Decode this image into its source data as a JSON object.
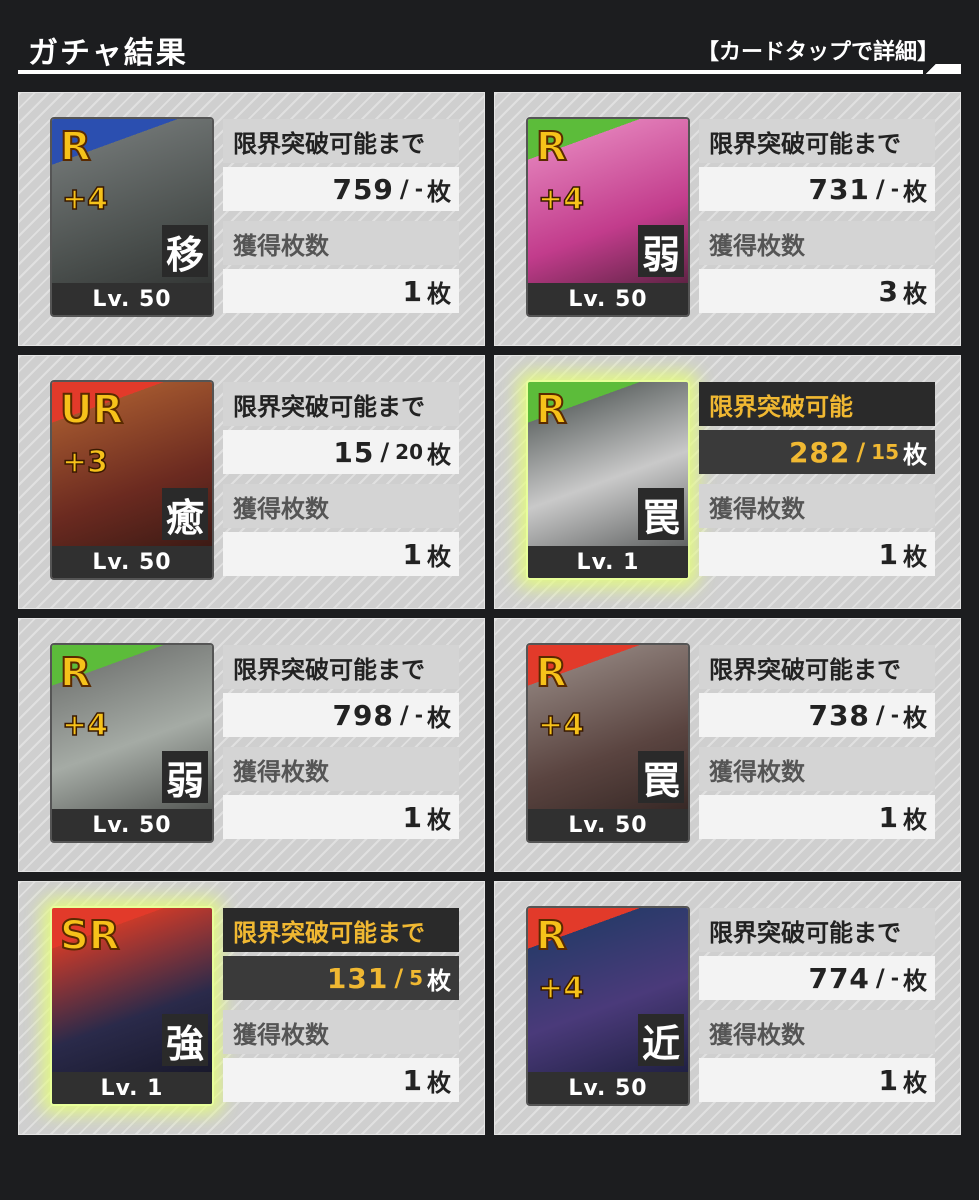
{
  "header": {
    "title": "ガチャ結果",
    "hint": "【カードタップで詳細】"
  },
  "labels": {
    "limit_until": "限界突破可能まで",
    "limit_ready": "限界突破可能",
    "obtained": "獲得枚数",
    "unit": "枚",
    "sep": "/"
  },
  "colors": {
    "rarity_gold": "#f6c21a",
    "highlight_text": "#f0b832",
    "panel_bg": "#cfcfcf"
  },
  "cards": [
    {
      "rarity": "R",
      "plus": "+4",
      "kanji": "移",
      "level": "Lv. 50",
      "status": "限界突破可能まで",
      "count": "759",
      "max": "-",
      "obtained": "1",
      "glow": false,
      "bg": "linear-gradient(160deg,#2b4fb0 0 18%, #6d7271 18%, #4a4f4d 60%, #2a2c2b)"
    },
    {
      "rarity": "R",
      "plus": "+4",
      "kanji": "弱",
      "level": "Lv. 50",
      "status": "限界突破可能まで",
      "count": "731",
      "max": "-",
      "obtained": "3",
      "glow": false,
      "bg": "linear-gradient(160deg,#5cbc3a 0 16%, #e07ab6 16%, #c23c8c 55%, #3a1a2a)"
    },
    {
      "rarity": "UR",
      "plus": "+3",
      "kanji": "癒",
      "level": "Lv. 50",
      "status": "限界突破可能まで",
      "count": "15",
      "max": "20",
      "obtained": "1",
      "glow": false,
      "bg": "linear-gradient(160deg,#e23a2a 0 16%, #a0552e 16%, #6b2a20 55%, #2a1410)"
    },
    {
      "rarity": "R",
      "plus": "",
      "kanji": "罠",
      "level": "Lv. 1",
      "status": "限界突破可能",
      "count": "282",
      "max": "15",
      "obtained": "1",
      "glow": true,
      "bg": "linear-gradient(160deg,#5cbc3a 0 16%, #6a6f6e 16%, #c9c9c9 50%, #3d4040)"
    },
    {
      "rarity": "R",
      "plus": "+4",
      "kanji": "弱",
      "level": "Lv. 50",
      "status": "限界突破可能まで",
      "count": "798",
      "max": "-",
      "obtained": "1",
      "glow": false,
      "bg": "linear-gradient(160deg,#5cbc3a 0 16%, #7a7d7a 16%, #a5aba5 50%, #3a3c3a)"
    },
    {
      "rarity": "R",
      "plus": "+4",
      "kanji": "罠",
      "level": "Lv. 50",
      "status": "限界突破可能まで",
      "count": "738",
      "max": "-",
      "obtained": "1",
      "glow": false,
      "bg": "linear-gradient(160deg,#e23a2a 0 16%, #8a7b76 16%, #5a4440 55%, #2a1e1c)"
    },
    {
      "rarity": "SR",
      "plus": "",
      "kanji": "強",
      "level": "Lv. 1",
      "status": "限界突破可能まで",
      "count": "131",
      "max": "5",
      "obtained": "1",
      "glow": true,
      "bg": "linear-gradient(160deg,#e23a2a 0 16%, #c83a2a 16%, #2a2a4a 55%, #121220)"
    },
    {
      "rarity": "R",
      "plus": "+4",
      "kanji": "近",
      "level": "Lv. 50",
      "status": "限界突破可能まで",
      "count": "774",
      "max": "-",
      "obtained": "1",
      "glow": false,
      "bg": "linear-gradient(160deg,#e23a2a 0 16%, #2a3a6a 16%, #4a3a7a 50%, #121830)"
    }
  ]
}
